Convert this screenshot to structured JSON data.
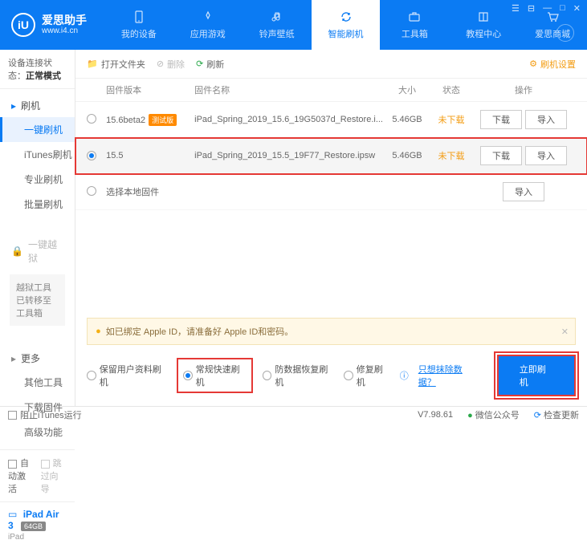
{
  "brand": {
    "name": "爱思助手",
    "url": "www.i4.cn",
    "logo_glyph": "iU"
  },
  "nav": [
    {
      "label": "我的设备"
    },
    {
      "label": "应用游戏"
    },
    {
      "label": "铃声壁纸"
    },
    {
      "label": "智能刷机"
    },
    {
      "label": "工具箱"
    },
    {
      "label": "教程中心"
    },
    {
      "label": "爱思商城"
    }
  ],
  "nav_active_index": 3,
  "connection": {
    "prefix": "设备连接状态：",
    "status": "正常模式"
  },
  "sidebar": {
    "group_flash": {
      "title": "刷机",
      "items": [
        "一键刷机",
        "iTunes刷机",
        "专业刷机",
        "批量刷机"
      ],
      "active_index": 0
    },
    "group_jail": {
      "title": "一键越狱",
      "note": "越狱工具已转移至工具箱"
    },
    "group_more": {
      "title": "更多",
      "items": [
        "其他工具",
        "下载固件",
        "高级功能"
      ]
    },
    "auto_activate": "自动激活",
    "skip_guide": "跳过向导"
  },
  "device": {
    "name": "iPad Air 3",
    "storage": "64GB",
    "type": "iPad"
  },
  "toolbar": {
    "open": "打开文件夹",
    "delete": "删除",
    "refresh": "刷新",
    "settings": "刷机设置"
  },
  "table": {
    "headers": {
      "version": "固件版本",
      "name": "固件名称",
      "size": "大小",
      "status": "状态",
      "ops": "操作"
    },
    "rows": [
      {
        "version": "15.6beta2",
        "tag": "测试版",
        "name": "iPad_Spring_2019_15.6_19G5037d_Restore.i...",
        "size": "5.46GB",
        "status": "未下载",
        "selected": false
      },
      {
        "version": "15.5",
        "tag": "",
        "name": "iPad_Spring_2019_15.5_19F77_Restore.ipsw",
        "size": "5.46GB",
        "status": "未下载",
        "selected": true
      }
    ],
    "local_row": "选择本地固件",
    "btn_download": "下载",
    "btn_import": "导入"
  },
  "notice": {
    "text": "如已绑定 Apple ID，请准备好 Apple ID和密码。"
  },
  "options": {
    "o1": "保留用户资料刷机",
    "o2": "常规快速刷机",
    "o3": "防数据恢复刷机",
    "o4": "修复刷机",
    "link": "只想抹除数据？",
    "primary": "立即刷机"
  },
  "statusbar": {
    "block_itunes": "阻止iTunes运行",
    "version": "V7.98.61",
    "wechat": "微信公众号",
    "check_update": "检查更新"
  }
}
